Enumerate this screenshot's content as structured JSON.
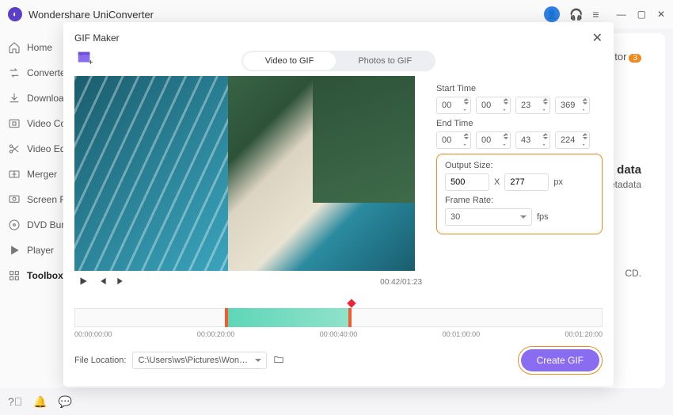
{
  "app": {
    "title": "Wondershare UniConverter"
  },
  "sidebar": {
    "items": [
      {
        "label": "Home"
      },
      {
        "label": "Converter"
      },
      {
        "label": "Downloader"
      },
      {
        "label": "Video Compressor"
      },
      {
        "label": "Video Editor"
      },
      {
        "label": "Merger"
      },
      {
        "label": "Screen Recorder"
      },
      {
        "label": "DVD Burner"
      },
      {
        "label": "Player"
      },
      {
        "label": "Toolbox"
      }
    ]
  },
  "bg": {
    "tor": "tor",
    "badge": "3",
    "data_label": "data",
    "etadata": "etadata",
    "cd": "CD."
  },
  "modal": {
    "title": "GIF Maker",
    "tabs": {
      "video": "Video to GIF",
      "photos": "Photos to GIF"
    },
    "start_label": "Start Time",
    "end_label": "End Time",
    "start": {
      "h": "00",
      "m": "00",
      "s": "23",
      "ms": "369"
    },
    "end": {
      "h": "00",
      "m": "00",
      "s": "43",
      "ms": "224"
    },
    "output_label": "Output Size:",
    "output": {
      "w": "500",
      "x": "X",
      "h": "277",
      "px": "px"
    },
    "frame_label": "Frame Rate:",
    "frame": {
      "rate": "30",
      "fps": "fps"
    },
    "playtime": "00:42/01:23",
    "ticks": [
      "00:00:00:00",
      "00:00:20:00",
      "00:00:40:00",
      "00:01:00:00",
      "00:01:20:00"
    ],
    "file_label": "File Location:",
    "file_path": "C:\\Users\\ws\\Pictures\\Wonders",
    "create": "Create GIF"
  }
}
